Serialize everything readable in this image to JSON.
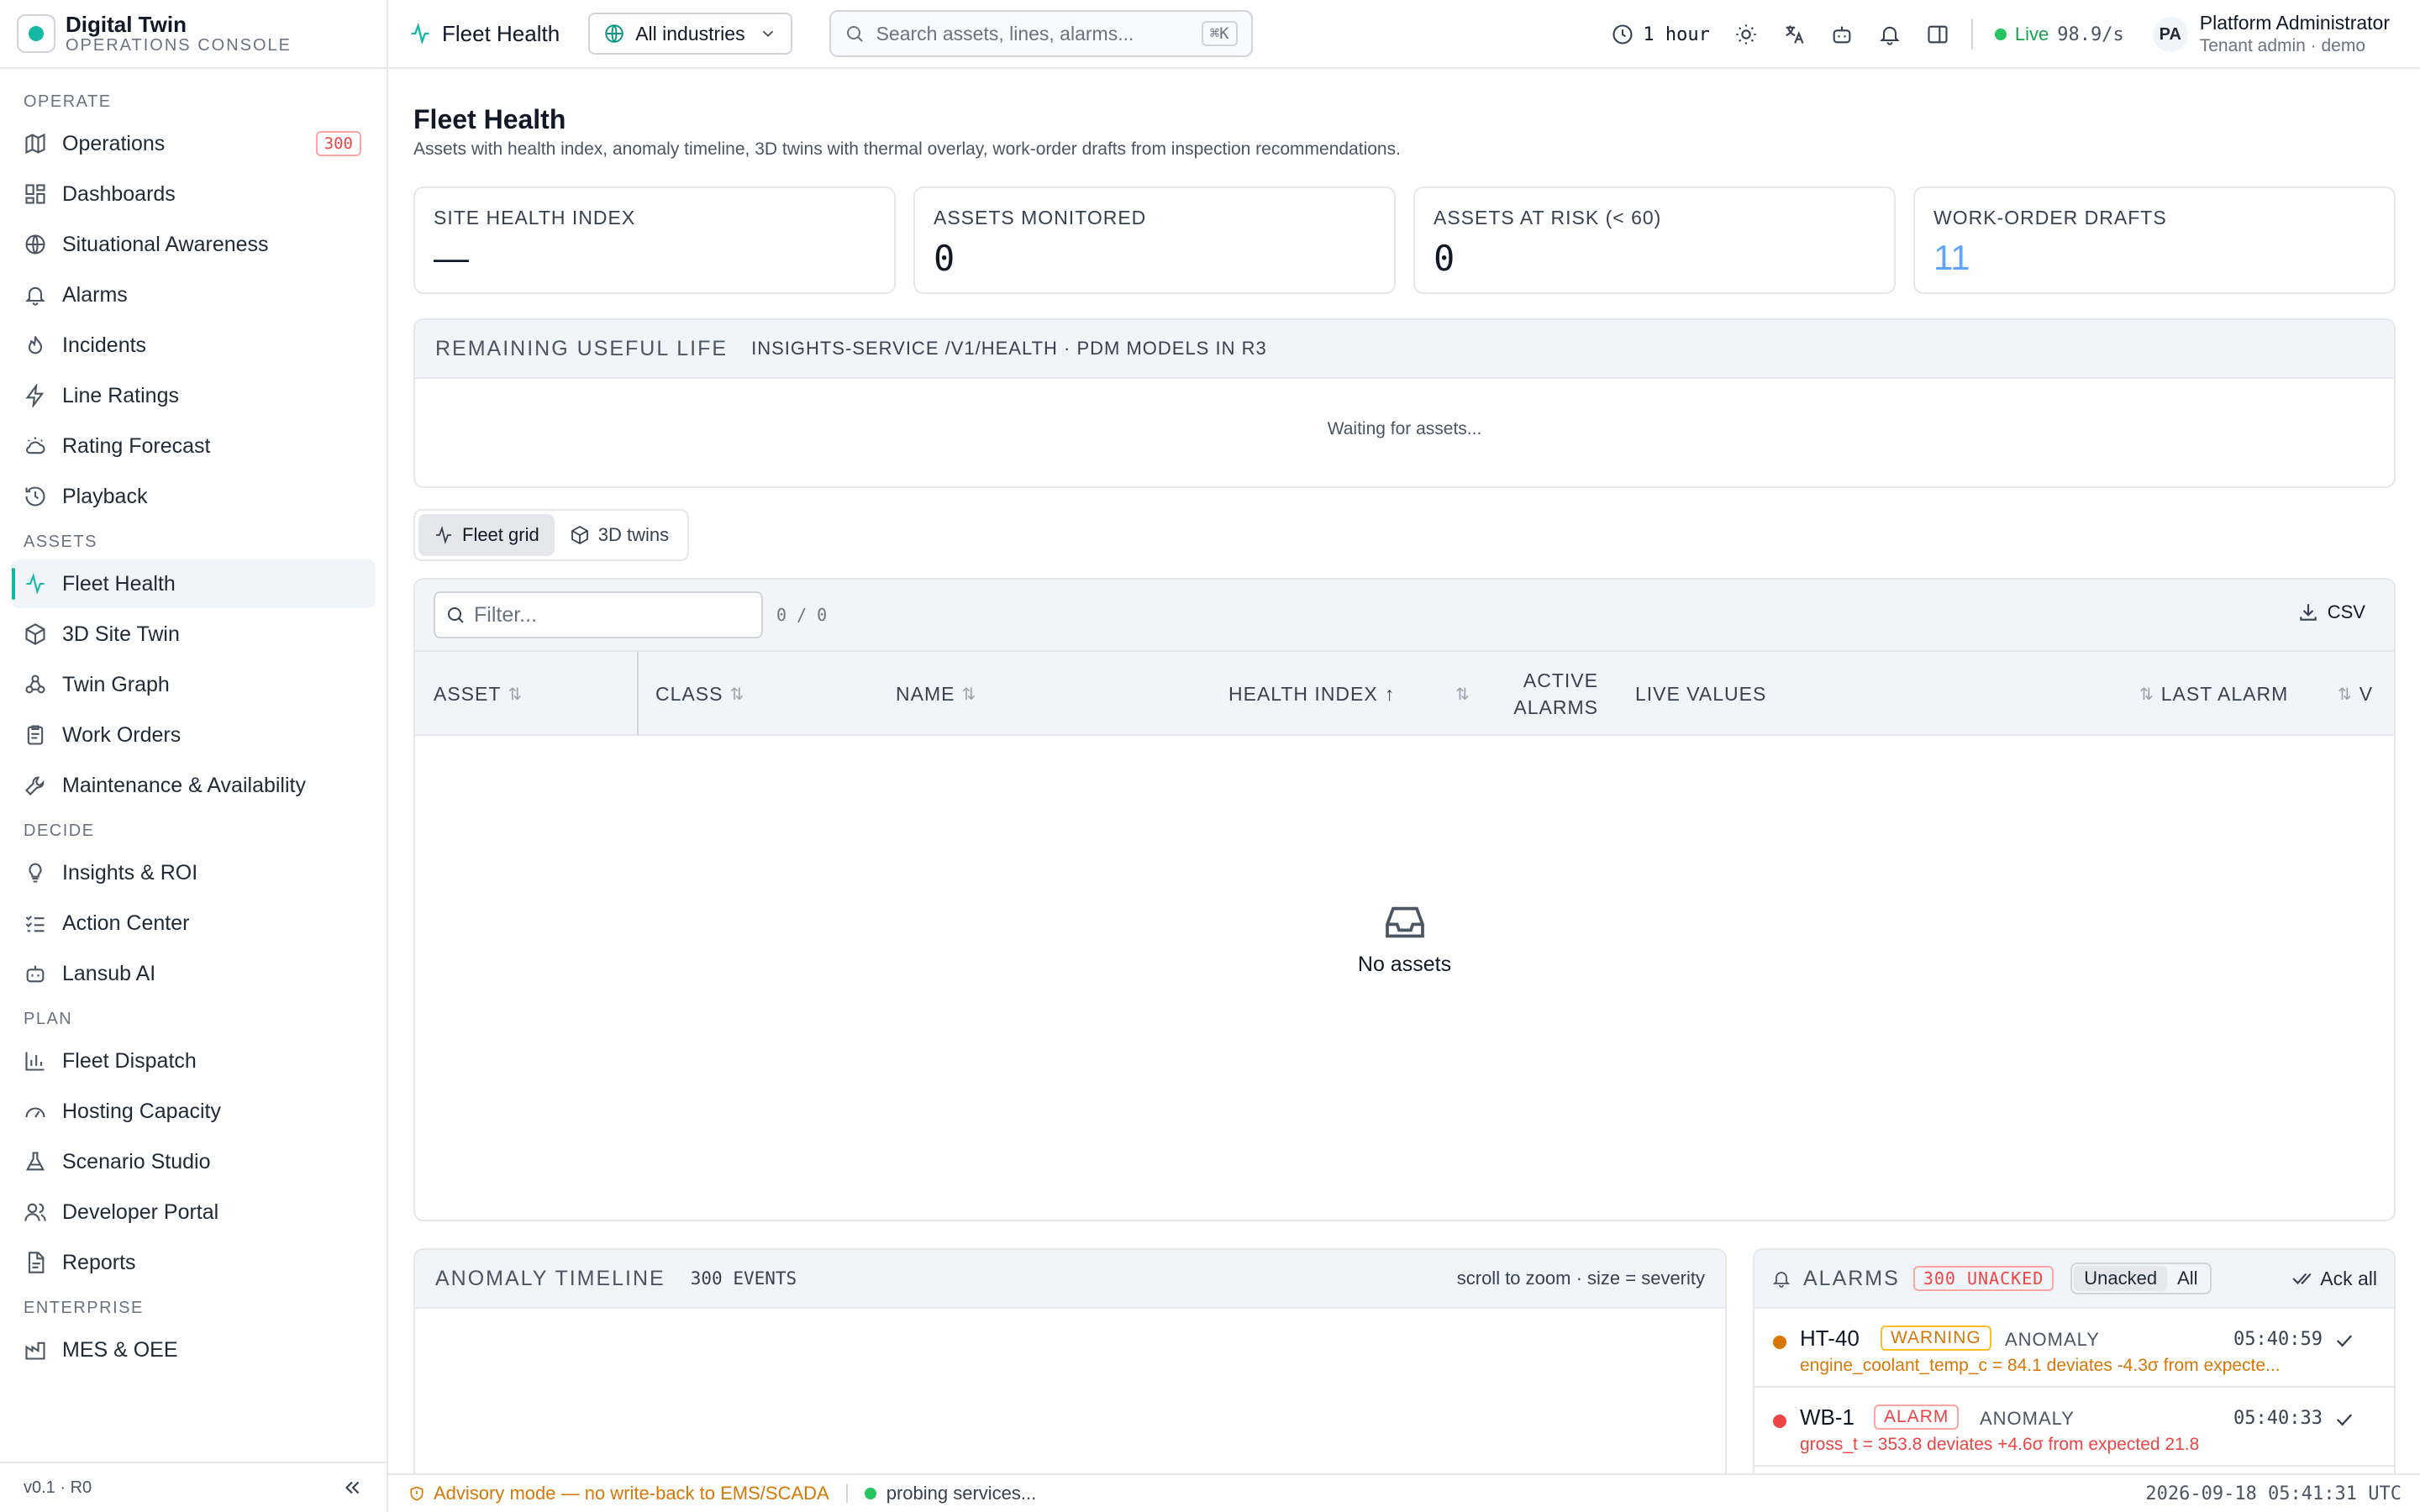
{
  "brand": {
    "name": "Digital Twin",
    "subtitle": "OPERATIONS CONSOLE"
  },
  "sidebar": {
    "sections": {
      "operate": "OPERATE",
      "assets": "ASSETS",
      "decide": "DECIDE",
      "plan": "PLAN",
      "enterprise": "ENTERPRISE"
    },
    "operate": [
      {
        "label": "Operations",
        "icon": "map-icon",
        "badge": "300"
      },
      {
        "label": "Dashboards",
        "icon": "grid-icon"
      },
      {
        "label": "Situational Awareness",
        "icon": "globe-icon"
      },
      {
        "label": "Alarms",
        "icon": "bell-icon"
      },
      {
        "label": "Incidents",
        "icon": "flame-icon"
      },
      {
        "label": "Line Ratings",
        "icon": "bolt-icon"
      },
      {
        "label": "Rating Forecast",
        "icon": "cloud-sun-icon"
      },
      {
        "label": "Playback",
        "icon": "history-icon"
      }
    ],
    "assets": [
      {
        "label": "Fleet Health",
        "icon": "activity-icon"
      },
      {
        "label": "3D Site Twin",
        "icon": "cube-icon"
      },
      {
        "label": "Twin Graph",
        "icon": "graph-icon"
      },
      {
        "label": "Work Orders",
        "icon": "clipboard-icon"
      },
      {
        "label": "Maintenance & Availability",
        "icon": "wrench-icon"
      }
    ],
    "decide": [
      {
        "label": "Insights & ROI",
        "icon": "lightbulb-icon"
      },
      {
        "label": "Action Center",
        "icon": "checklist-icon"
      },
      {
        "label": "Lansub AI",
        "icon": "bot-icon"
      }
    ],
    "plan": [
      {
        "label": "Fleet Dispatch",
        "icon": "bar-chart-icon"
      },
      {
        "label": "Hosting Capacity",
        "icon": "gauge-icon"
      },
      {
        "label": "Scenario Studio",
        "icon": "flask-icon"
      },
      {
        "label": "Developer Portal",
        "icon": "users-icon"
      },
      {
        "label": "Reports",
        "icon": "report-icon"
      }
    ],
    "enterprise": [
      {
        "label": "MES & OEE",
        "icon": "factory-icon"
      }
    ],
    "version": "v0.1 · R0"
  },
  "topbar": {
    "page": "Fleet Health",
    "industry": "All industries",
    "search_placeholder": "Search assets, lines, alarms...",
    "search_kbd": "⌘K",
    "time_range": "1 hour",
    "live_label": "Live",
    "live_rate": "98.9/s",
    "avatar": "PA",
    "user_name": "Platform Administrator",
    "user_role": "Tenant admin · demo"
  },
  "page": {
    "title": "Fleet Health",
    "description": "Assets with health index, anomaly timeline, 3D twins with thermal overlay, work-order drafts from inspection recommendations."
  },
  "kpis": [
    {
      "label": "SITE HEALTH INDEX",
      "value": "—",
      "color": "#111827"
    },
    {
      "label": "ASSETS MONITORED",
      "value": "0",
      "color": "#111827"
    },
    {
      "label": "ASSETS AT RISK (< 60)",
      "value": "0",
      "color": "#111827"
    },
    {
      "label": "WORK-ORDER DRAFTS",
      "value": "11",
      "color": "#60a5fa"
    }
  ],
  "rul": {
    "title": "REMAINING USEFUL LIFE",
    "subtitle": "INSIGHTS-SERVICE /V1/HEALTH · PDM MODELS IN R3",
    "empty": "Waiting for assets..."
  },
  "view_tabs": [
    {
      "label": "Fleet grid",
      "icon": "activity-icon"
    },
    {
      "label": "3D twins",
      "icon": "cube-icon"
    }
  ],
  "grid": {
    "filter_placeholder": "Filter...",
    "count": "0 / 0",
    "csv": "CSV",
    "columns": {
      "asset": "ASSET",
      "class": "CLASS",
      "name": "NAME",
      "health": "HEALTH INDEX",
      "active_alarms_1": "ACTIVE",
      "active_alarms_2": "ALARMS",
      "live_values": "LIVE VALUES",
      "last_alarm": "LAST ALARM",
      "v": "V"
    },
    "empty": "No assets"
  },
  "timeline": {
    "title": "ANOMALY TIMELINE",
    "count": "300 EVENTS",
    "hint": "scroll to zoom · size = severity"
  },
  "alarms": {
    "title": "ALARMS",
    "unacked": "300 UNACKED",
    "tab_unacked": "Unacked",
    "tab_all": "All",
    "ack_all": "Ack all",
    "items": [
      {
        "asset": "HT-40",
        "severity": "WARNING",
        "type": "ANOMALY",
        "time": "05:40:59",
        "message": "engine_coolant_temp_c = 84.1 deviates -4.3σ from expecte...",
        "color": "#d97706"
      },
      {
        "asset": "WB-1",
        "severity": "ALARM",
        "type": "ANOMALY",
        "time": "05:40:33",
        "message": "gross_t = 353.8 deviates +4.6σ from expected 21.8",
        "color": "#ef4444"
      }
    ]
  },
  "status": {
    "advisory": "Advisory mode — no write-back to EMS/SCADA",
    "probing": "probing services...",
    "clock": "2026-09-18 05:41:31 UTC"
  }
}
